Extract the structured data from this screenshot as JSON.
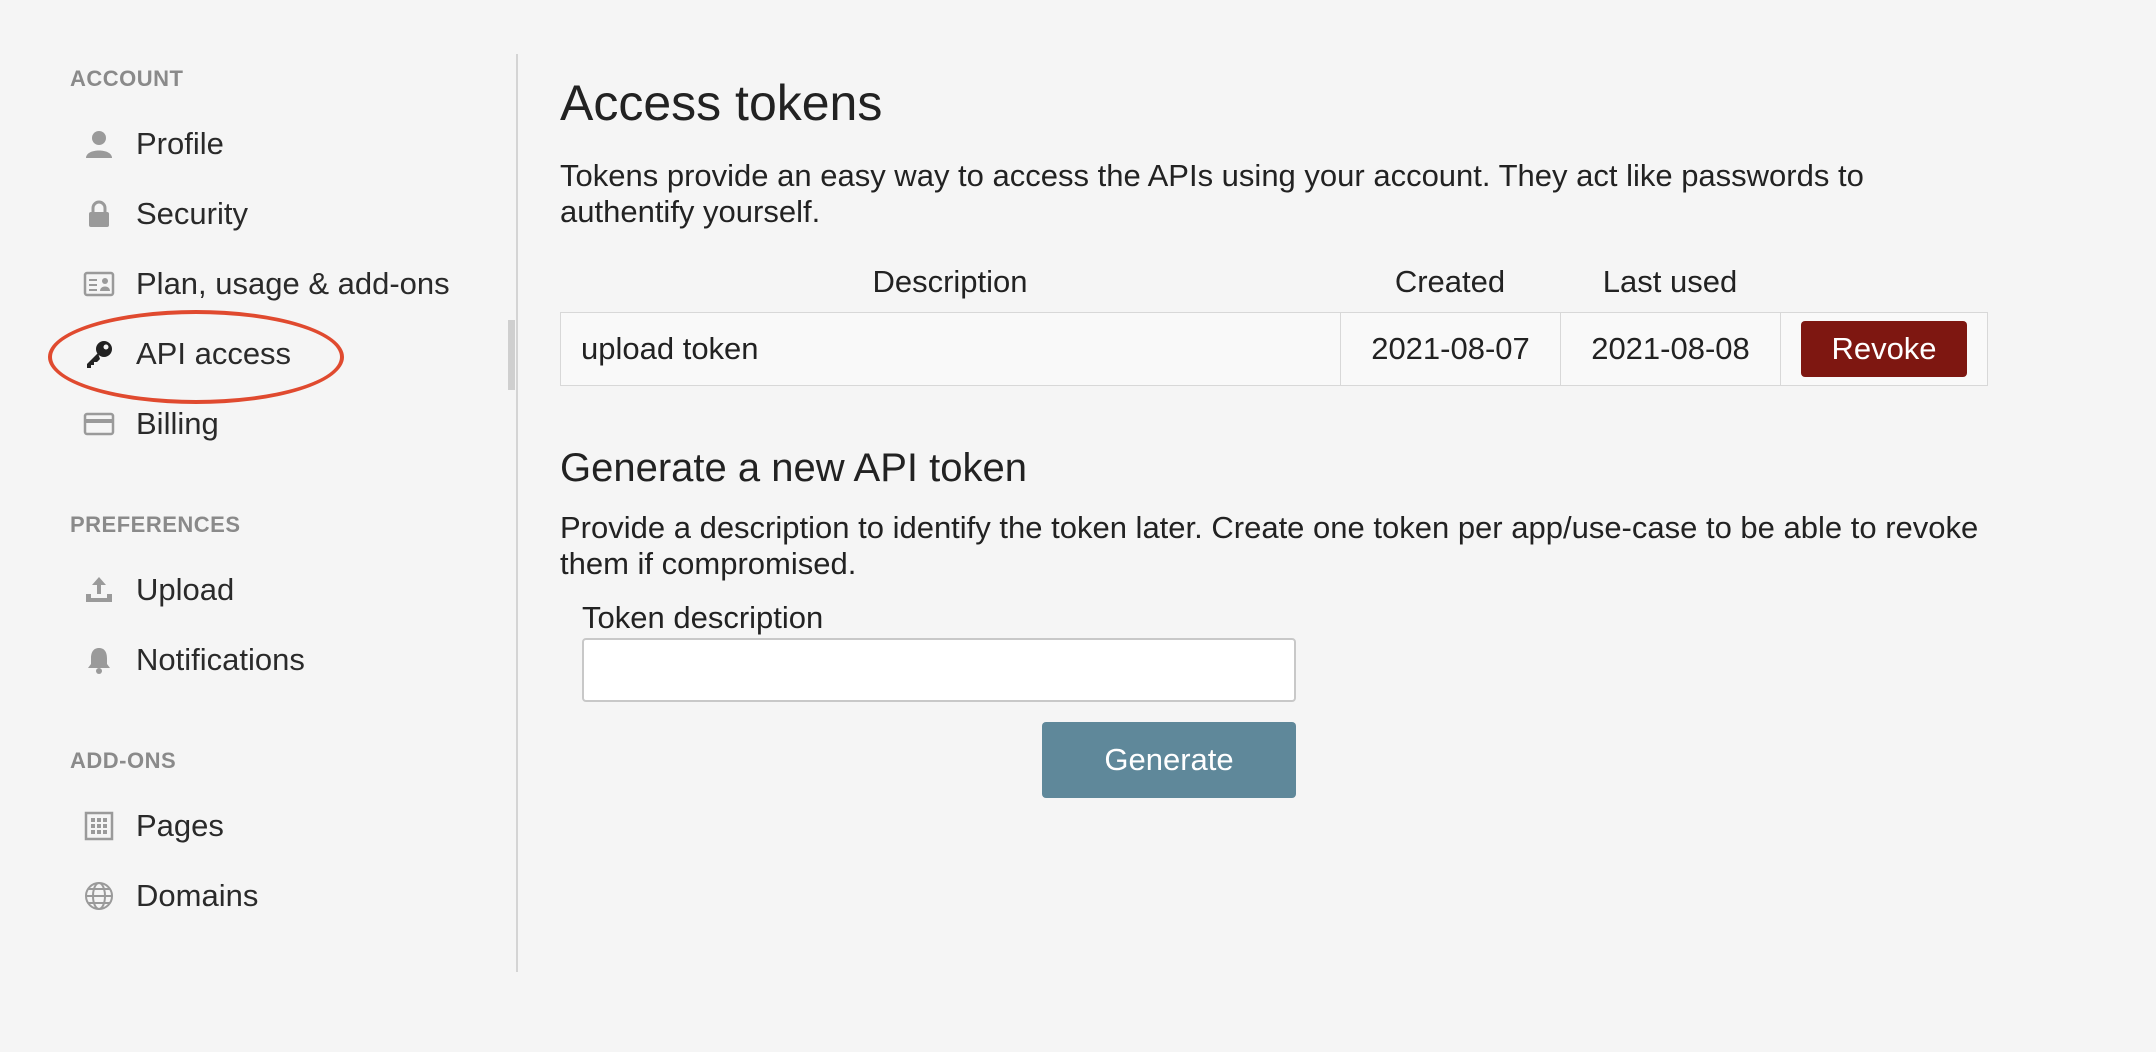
{
  "sidebar": {
    "sections": [
      {
        "title": "ACCOUNT",
        "items": [
          {
            "label": "Profile",
            "icon": "user-icon"
          },
          {
            "label": "Security",
            "icon": "lock-icon"
          },
          {
            "label": "Plan, usage & add-ons",
            "icon": "id-card-icon"
          },
          {
            "label": "API access",
            "icon": "key-icon",
            "active": true
          },
          {
            "label": "Billing",
            "icon": "credit-card-icon"
          }
        ]
      },
      {
        "title": "PREFERENCES",
        "items": [
          {
            "label": "Upload",
            "icon": "upload-icon"
          },
          {
            "label": "Notifications",
            "icon": "bell-icon"
          }
        ]
      },
      {
        "title": "ADD-ONS",
        "items": [
          {
            "label": "Pages",
            "icon": "grid-icon"
          },
          {
            "label": "Domains",
            "icon": "globe-icon"
          }
        ]
      }
    ]
  },
  "main": {
    "title": "Access tokens",
    "intro": "Tokens provide an easy way to access the APIs using your account. They act like passwords to authentify yourself.",
    "table": {
      "headers": {
        "description": "Description",
        "created": "Created",
        "last_used": "Last used"
      },
      "rows": [
        {
          "description": "upload token",
          "created": "2021-08-07",
          "last_used": "2021-08-08",
          "action": "Revoke"
        }
      ]
    },
    "generate": {
      "heading": "Generate a new API token",
      "intro": "Provide a description to identify the token later. Create one token per app/use-case to be able to revoke them if compromised.",
      "field_label": "Token description",
      "field_value": "",
      "button": "Generate"
    }
  },
  "colors": {
    "revoke": "#7e1711",
    "generate": "#5f889a",
    "highlight": "#e04a2f"
  }
}
